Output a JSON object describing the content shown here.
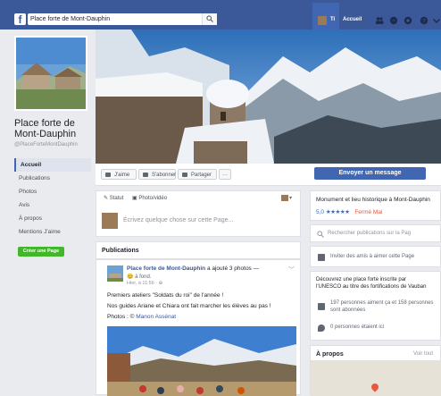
{
  "topbar": {
    "logo": "f",
    "search_value": "Place forte de Mont-Dauphin",
    "user_name": "Ti",
    "home_label": "Accueil",
    "icons": [
      "friends-icon",
      "messenger-icon",
      "globe-icon",
      "help-icon",
      "chevron-down-icon"
    ],
    "brand_color": "#3b5998"
  },
  "page": {
    "name": "Place forte de Mont-Dauphin",
    "handle": "@PlaceForteMontDauphin"
  },
  "nav": {
    "items": [
      "Accueil",
      "Publications",
      "Photos",
      "Avis",
      "À propos",
      "Mentions J'aime"
    ],
    "active": "Accueil",
    "create_page": "Créer une Page"
  },
  "actions": {
    "like": "J'aime",
    "follow": "S'abonner",
    "share": "Partager",
    "more": "···",
    "send_message": "Envoyer un message"
  },
  "composer": {
    "status": "Statut",
    "photo_video": "Photo/vidéo",
    "placeholder": "Écrivez quelque chose sur cette Page..."
  },
  "publications": {
    "title": "Publications"
  },
  "post": {
    "author": "Place forte de Mont-Dauphin",
    "action": "a ajouté 3 photos —",
    "feeling": "😊 à fond.",
    "time": "Hier, à 11:56 · ⊕",
    "lines": [
      "Premiers ateliers \"Soldats du roi\" de l'année !",
      "Nos guides Ariane et Chiara ont fait marcher les élèves au pas !"
    ],
    "credit_prefix": "Photos : ©",
    "credit_name": "Manon Assénat"
  },
  "about_card": {
    "category": "Monument et lieu historique à Mont-Dauphin",
    "rating": "5,0",
    "stars": "★★★★★",
    "status": "Fermé Mai"
  },
  "right": {
    "search_placeholder": "Rechercher publications sur la Pag",
    "invite": "Inviter des amis à aimer cette Page",
    "discover_line1": "Découvrez une place forte inscrite par",
    "discover_line2": "l'UNESCO au titre des fortifications de Vauban",
    "likes_line1": "197 personnes aiment ça et 158 personnes",
    "likes_line2": "sont abonnées",
    "checkins": "0 personnes étaient ici",
    "about_title": "À propos",
    "see_all": "Voir tout"
  }
}
